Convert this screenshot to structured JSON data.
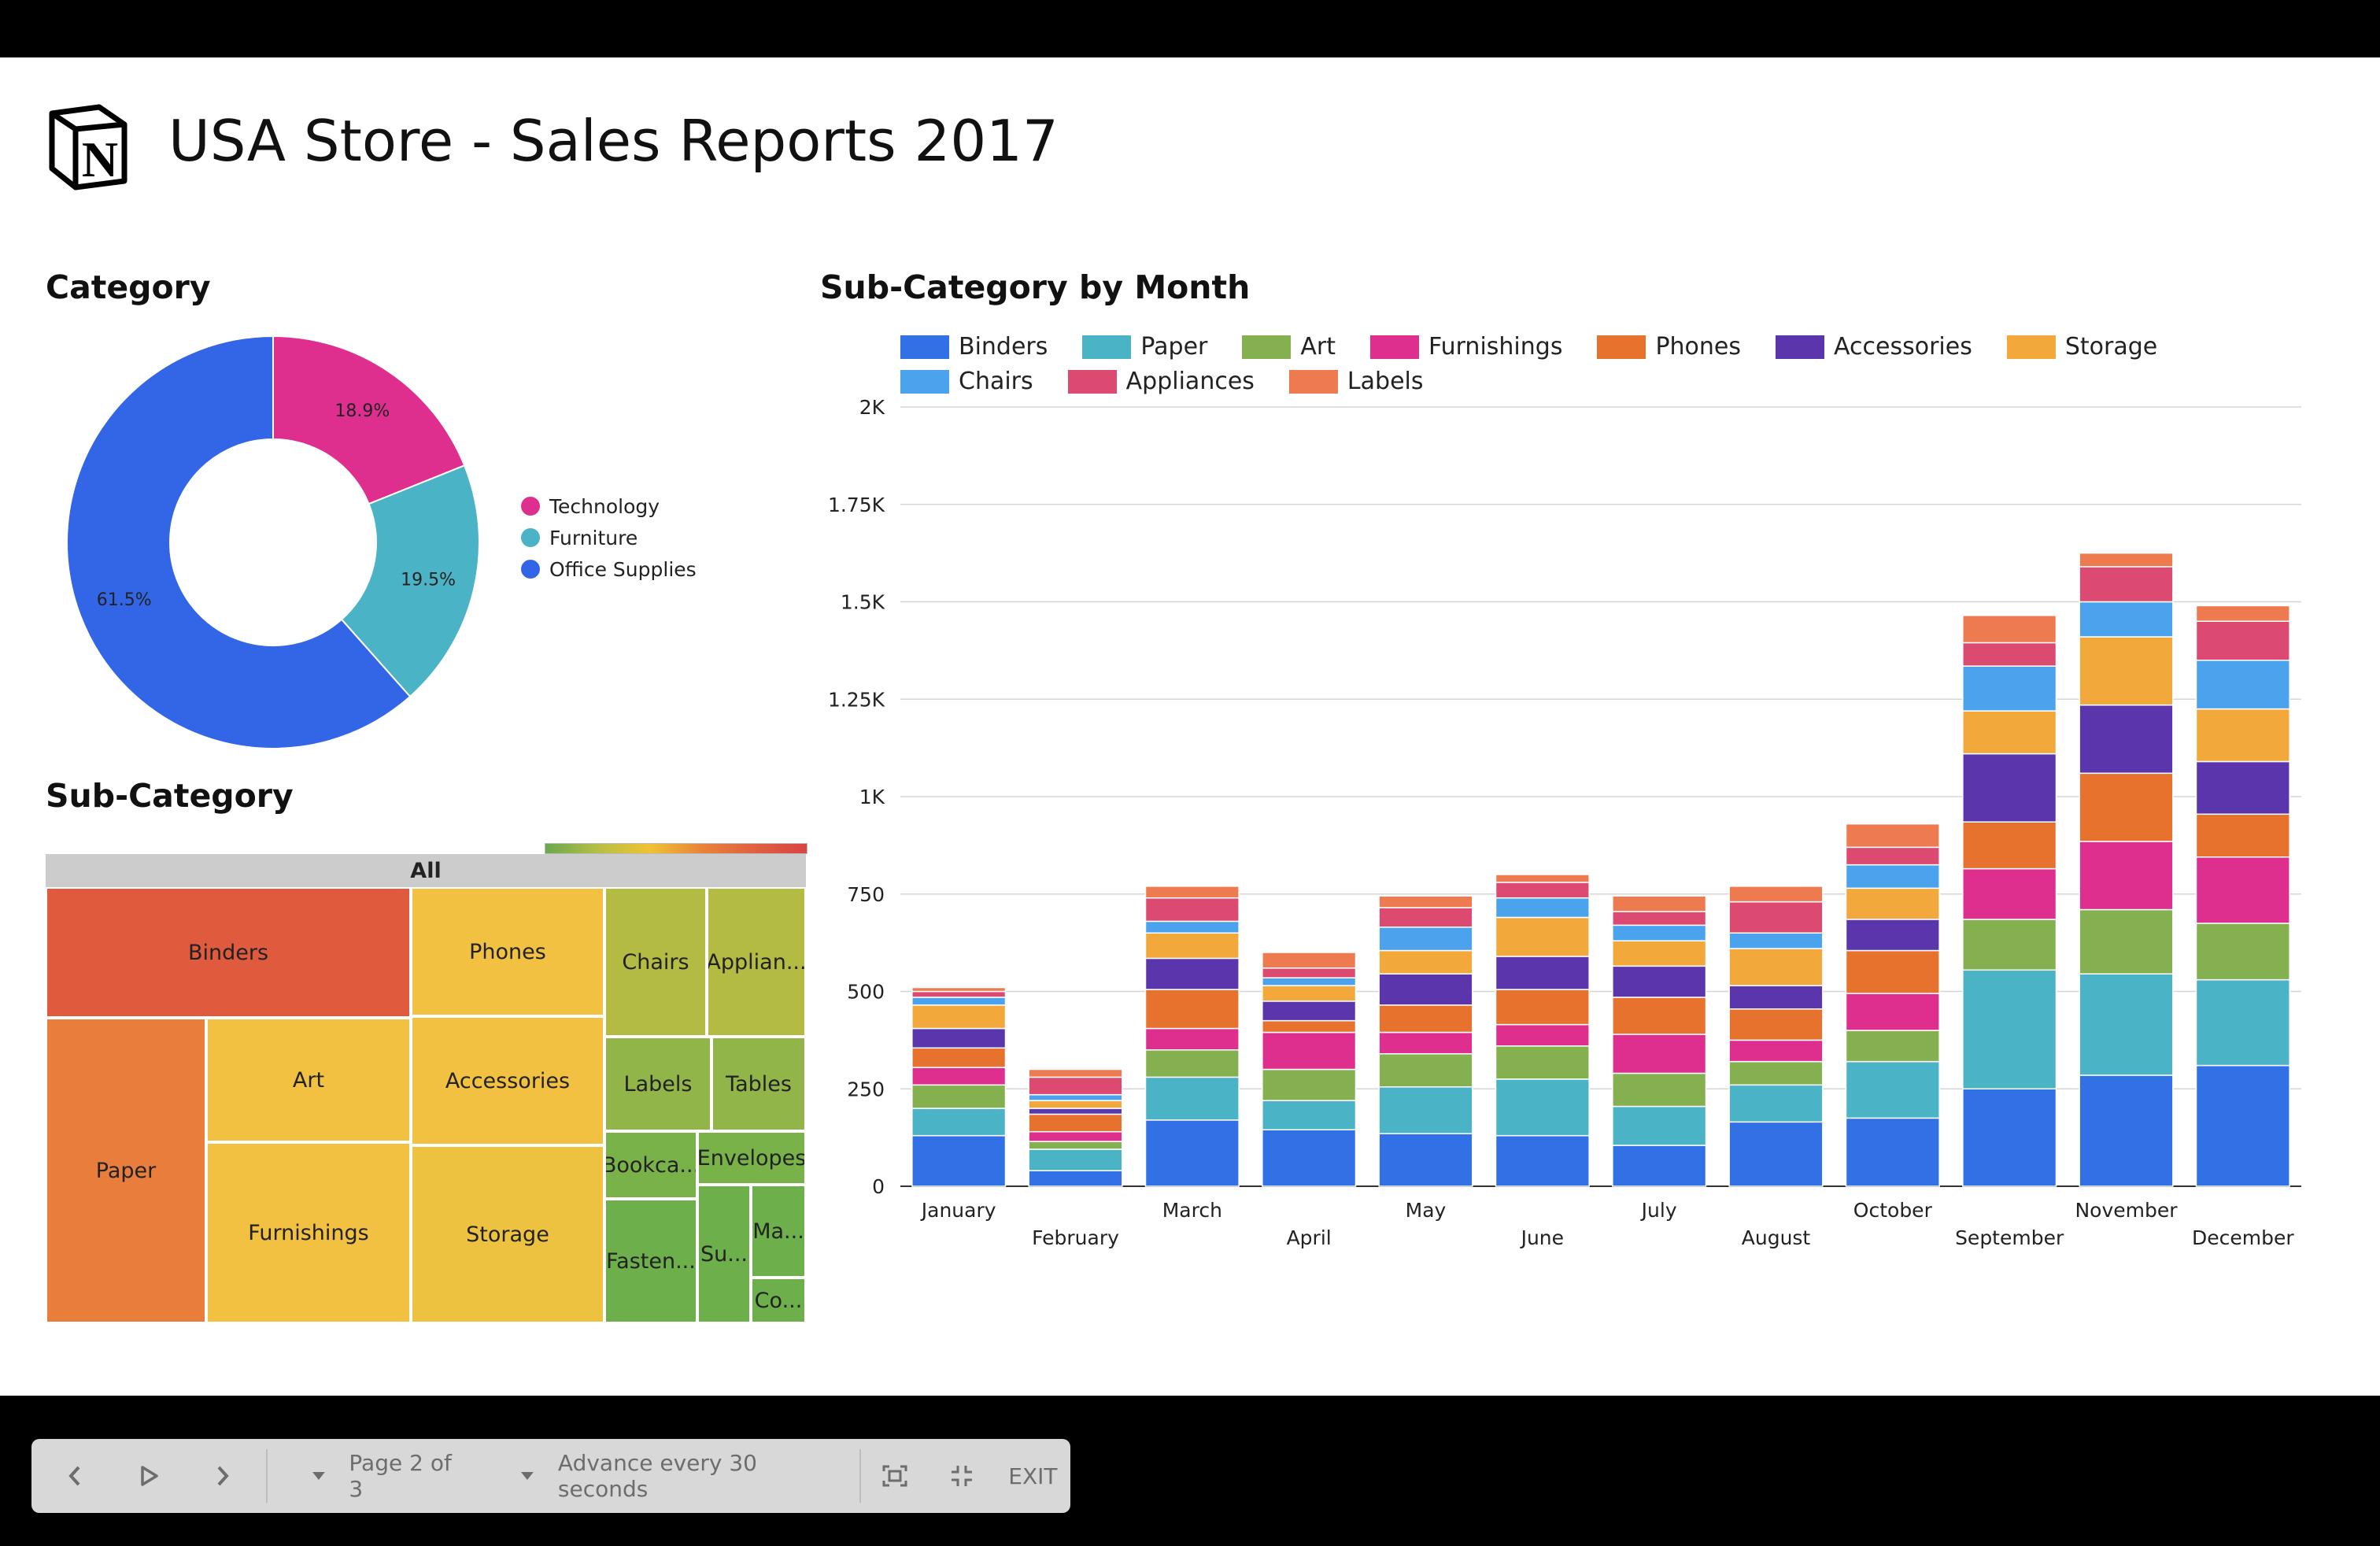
{
  "header": {
    "title": "USA Store - Sales Reports 2017",
    "logo_letter": "N"
  },
  "category": {
    "title": "Category",
    "colors": [
      "#de2f8f",
      "#4ab3c6",
      "#3366e6"
    ]
  },
  "subcategory": {
    "title": "Sub-Category",
    "root_label": "All",
    "cells": [
      {
        "label": "Binders",
        "color": "#e05a3e"
      },
      {
        "label": "Paper",
        "color": "#e97d3c"
      },
      {
        "label": "Art",
        "color": "#f2c141"
      },
      {
        "label": "Furnishings",
        "color": "#f2c141"
      },
      {
        "label": "Phones",
        "color": "#f2c141"
      },
      {
        "label": "Accessories",
        "color": "#f2c141"
      },
      {
        "label": "Storage",
        "color": "#edc240"
      },
      {
        "label": "Chairs",
        "color": "#b4bb43"
      },
      {
        "label": "Applian...",
        "color": "#b4bb43"
      },
      {
        "label": "Labels",
        "color": "#91b548"
      },
      {
        "label": "Tables",
        "color": "#91b548"
      },
      {
        "label": "Bookca...",
        "color": "#7ab24a"
      },
      {
        "label": "Envelopes",
        "color": "#7ab24a"
      },
      {
        "label": "Fasten...",
        "color": "#6daf4b"
      },
      {
        "label": "Su...",
        "color": "#6daf4b"
      },
      {
        "label": "Ma...",
        "color": "#6daf4b"
      },
      {
        "label": "Co...",
        "color": "#6daf4b"
      }
    ]
  },
  "subcategory_by_month": {
    "title": "Sub-Category by Month",
    "colors": [
      "#3270e6",
      "#4ab3c6",
      "#84b04f",
      "#de2f8f",
      "#e6722e",
      "#5b35ab",
      "#f2a83a",
      "#4aa3ec",
      "#dc4a72",
      "#ee7b4f"
    ]
  },
  "chart_data": [
    {
      "type": "pie",
      "title": "Category",
      "labels": [
        "Technology",
        "Furniture",
        "Office Supplies"
      ],
      "values": [
        18.9,
        19.5,
        61.5
      ],
      "value_labels": [
        "18.9%",
        "19.5%",
        "61.5%"
      ],
      "legend": "right"
    },
    {
      "type": "bar",
      "stacked": true,
      "title": "Sub-Category by Month",
      "categories": [
        "January",
        "February",
        "March",
        "April",
        "May",
        "June",
        "July",
        "August",
        "October",
        "September",
        "November",
        "December"
      ],
      "series": [
        {
          "name": "Binders",
          "values": [
            130,
            40,
            170,
            145,
            135,
            130,
            105,
            165,
            175,
            250,
            285,
            310
          ]
        },
        {
          "name": "Paper",
          "values": [
            70,
            55,
            110,
            75,
            120,
            145,
            100,
            95,
            145,
            305,
            260,
            220
          ]
        },
        {
          "name": "Art",
          "values": [
            60,
            20,
            70,
            80,
            85,
            85,
            85,
            60,
            80,
            130,
            165,
            145
          ]
        },
        {
          "name": "Furnishings",
          "values": [
            45,
            25,
            55,
            95,
            55,
            55,
            100,
            55,
            95,
            130,
            175,
            170
          ]
        },
        {
          "name": "Phones",
          "values": [
            50,
            45,
            100,
            30,
            70,
            90,
            95,
            80,
            110,
            120,
            175,
            110
          ]
        },
        {
          "name": "Accessories",
          "values": [
            50,
            15,
            80,
            50,
            80,
            85,
            80,
            60,
            80,
            175,
            175,
            135
          ]
        },
        {
          "name": "Storage",
          "values": [
            60,
            20,
            65,
            40,
            60,
            100,
            65,
            95,
            80,
            110,
            175,
            135
          ]
        },
        {
          "name": "Chairs",
          "values": [
            20,
            15,
            30,
            20,
            60,
            50,
            40,
            40,
            60,
            115,
            90,
            125
          ]
        },
        {
          "name": "Appliances",
          "values": [
            15,
            45,
            60,
            25,
            50,
            40,
            35,
            80,
            45,
            60,
            90,
            100
          ]
        },
        {
          "name": "Labels",
          "values": [
            10,
            20,
            30,
            40,
            30,
            20,
            40,
            40,
            60,
            70,
            35,
            40
          ]
        }
      ],
      "yticks": [
        "0",
        "250",
        "500",
        "750",
        "1K",
        "1.25K",
        "1.5K",
        "1.75K",
        "2K"
      ],
      "ylim": [
        0,
        2000
      ],
      "legend": "top",
      "grid": true
    }
  ],
  "controls": {
    "page_label": "Page 2 of 3",
    "advance_label": "Advance every 30 seconds",
    "exit_label": "EXIT"
  }
}
